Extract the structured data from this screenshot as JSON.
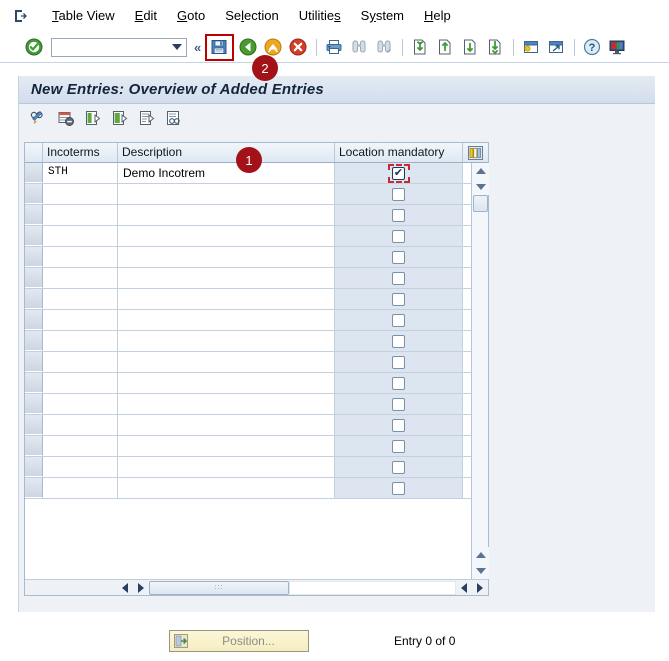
{
  "menubar": {
    "system_icon": "sap-system-menu-icon",
    "items": [
      {
        "label": "Table View",
        "accel": "T"
      },
      {
        "label": "Edit",
        "accel": "E"
      },
      {
        "label": "Goto",
        "accel": "G"
      },
      {
        "label": "Selection",
        "accel": "l"
      },
      {
        "label": "Utilities",
        "accel": "s"
      },
      {
        "label": "System",
        "accel": "y"
      },
      {
        "label": "Help",
        "accel": "H"
      }
    ]
  },
  "toolbar": {
    "enter_icon": "green-check-icon",
    "command_field": {
      "value": "",
      "placeholder": ""
    },
    "collapse_icon": "double-chevron-left-icon",
    "save_icon": "save-floppy-icon",
    "back_icon": "back-green-arrow-icon",
    "exit_icon": "exit-yellow-arrow-icon",
    "cancel_icon": "cancel-red-x-icon",
    "print_icon": "printer-icon",
    "find_icon": "binoculars-find-icon",
    "find_next_icon": "binoculars-find-next-icon",
    "first_page_icon": "first-page-icon",
    "prev_page_icon": "previous-page-icon",
    "next_page_icon": "next-page-icon",
    "last_page_icon": "last-page-icon",
    "create_session_icon": "create-session-icon",
    "shortcut_icon": "create-shortcut-icon",
    "help_icon": "help-question-icon",
    "layout_icon": "customize-local-layout-icon"
  },
  "screen": {
    "title": "New Entries: Overview of Added Entries",
    "app_toolbar": [
      {
        "icon": "display-change-glasses-pencil-icon",
        "name": "display-change-button"
      },
      {
        "icon": "delete-row-icon",
        "name": "delete-row-button"
      },
      {
        "icon": "new-entries-green-icon",
        "name": "copy-as-button"
      },
      {
        "icon": "select-block-green-icon",
        "name": "select-block-button"
      },
      {
        "icon": "undo-entry-icon",
        "name": "undo-change-button"
      },
      {
        "icon": "display-details-glasses-icon",
        "name": "details-button"
      }
    ]
  },
  "table": {
    "columns": [
      {
        "key": "incoterms",
        "label": "Incoterms"
      },
      {
        "key": "description",
        "label": "Description"
      },
      {
        "key": "location_mandatory",
        "label": "Location mandatory"
      }
    ],
    "settings_icon": "table-column-settings-icon",
    "rows": [
      {
        "incoterms": "STH",
        "description": "Demo Incotrem",
        "location_mandatory": true,
        "highlighted": true
      },
      {
        "incoterms": "",
        "description": "",
        "location_mandatory": false,
        "highlighted": false
      },
      {
        "incoterms": "",
        "description": "",
        "location_mandatory": false,
        "highlighted": false
      },
      {
        "incoterms": "",
        "description": "",
        "location_mandatory": false,
        "highlighted": false
      },
      {
        "incoterms": "",
        "description": "",
        "location_mandatory": false,
        "highlighted": false
      },
      {
        "incoterms": "",
        "description": "",
        "location_mandatory": false,
        "highlighted": false
      },
      {
        "incoterms": "",
        "description": "",
        "location_mandatory": false,
        "highlighted": false
      },
      {
        "incoterms": "",
        "description": "",
        "location_mandatory": false,
        "highlighted": false
      },
      {
        "incoterms": "",
        "description": "",
        "location_mandatory": false,
        "highlighted": false
      },
      {
        "incoterms": "",
        "description": "",
        "location_mandatory": false,
        "highlighted": false
      },
      {
        "incoterms": "",
        "description": "",
        "location_mandatory": false,
        "highlighted": false
      },
      {
        "incoterms": "",
        "description": "",
        "location_mandatory": false,
        "highlighted": false
      },
      {
        "incoterms": "",
        "description": "",
        "location_mandatory": false,
        "highlighted": false
      },
      {
        "incoterms": "",
        "description": "",
        "location_mandatory": false,
        "highlighted": false
      },
      {
        "incoterms": "",
        "description": "",
        "location_mandatory": false,
        "highlighted": false
      },
      {
        "incoterms": "",
        "description": "",
        "location_mandatory": false,
        "highlighted": false
      }
    ]
  },
  "scrollbars": {
    "v_up_icon": "scroll-up-icon",
    "v_down_icon": "scroll-down-icon",
    "h_left_icon": "scroll-left-icon",
    "h_right_icon": "scroll-right-icon",
    "h_thumb_grip": "∶∶∶"
  },
  "footer": {
    "position_button": {
      "label": "Position...",
      "icon": "position-jump-icon",
      "enabled": false
    },
    "entry_count": "Entry 0 of 0"
  },
  "annotations": [
    {
      "id": "1",
      "label": "1",
      "target": "location-mandatory-checkbox"
    },
    {
      "id": "2",
      "label": "2",
      "target": "save-button"
    }
  ],
  "colors": {
    "badge_red": "#a31219",
    "highlight_red": "#c00000",
    "checkbox_col_bg": "#dce5f0",
    "title_text": "#14243a"
  }
}
